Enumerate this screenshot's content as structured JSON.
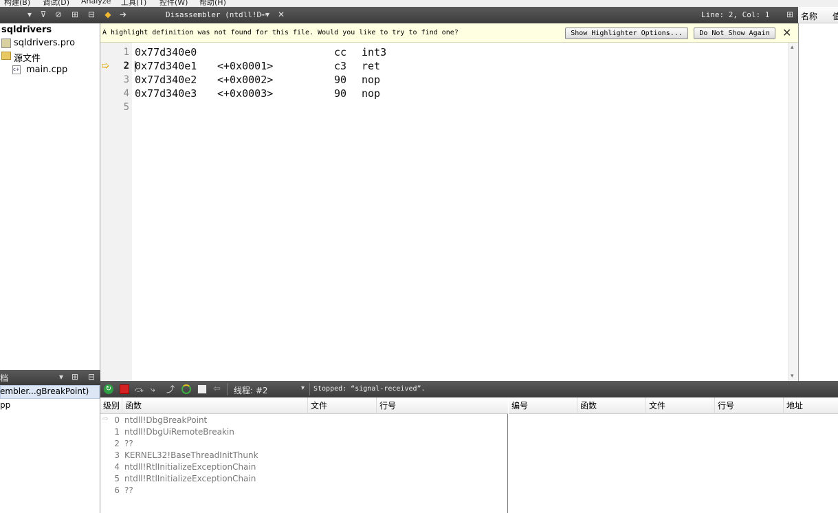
{
  "menu": [
    "构建(B)",
    "调试(D)",
    "Analyze",
    "工具(T)",
    "控件(W)",
    "帮助(H)"
  ],
  "left_tree": {
    "project": "sqldrivers",
    "pro_file": "sqldrivers.pro",
    "folder": "源文件",
    "source": "main.cpp"
  },
  "left_bottom": {
    "title": "档",
    "item1": "embler...gBreakPoint)",
    "item2": "pp"
  },
  "editor_bar": {
    "title": "Disassembler (ntdll!D⋯",
    "line_col": "Line: 2, Col: 1"
  },
  "infobar": {
    "message": "A highlight definition was not found for this file. Would you like to try to find one?",
    "show_btn": "Show Highlighter Options...",
    "dont_btn": "Do Not Show Again"
  },
  "code_lines": [
    {
      "num": "1",
      "addr": "0x77d340e0",
      "off": "",
      "hex": "cc",
      "ins": "int3"
    },
    {
      "num": "2",
      "addr": "0x77d340e1",
      "off": "<+0x0001>",
      "hex": "c3",
      "ins": "ret"
    },
    {
      "num": "3",
      "addr": "0x77d340e2",
      "off": "<+0x0002>",
      "hex": "90",
      "ins": "nop"
    },
    {
      "num": "4",
      "addr": "0x77d340e3",
      "off": "<+0x0003>",
      "hex": "90",
      "ins": "nop"
    },
    {
      "num": "5",
      "addr": "",
      "off": "",
      "hex": "",
      "ins": ""
    }
  ],
  "right_pane": {
    "col1": "名称",
    "col2": "值"
  },
  "debug_bar": {
    "thread": "线程: #2",
    "status": "Stopped: “signal-received”."
  },
  "stack": {
    "headers": [
      "级别",
      "函数",
      "文件",
      "行号"
    ],
    "rows": [
      {
        "level": "0",
        "func": "ntdll!DbgBreakPoint"
      },
      {
        "level": "1",
        "func": "ntdll!DbgUiRemoteBreakin"
      },
      {
        "level": "2",
        "func": "??"
      },
      {
        "level": "3",
        "func": "KERNEL32!BaseThreadInitThunk"
      },
      {
        "level": "4",
        "func": "ntdll!RtlInitializeExceptionChain"
      },
      {
        "level": "5",
        "func": "ntdll!RtlInitializeExceptionChain"
      },
      {
        "level": "6",
        "func": "??"
      }
    ]
  },
  "breakpoints": {
    "headers": [
      "编号",
      "函数",
      "文件",
      "行号",
      "地址"
    ]
  }
}
